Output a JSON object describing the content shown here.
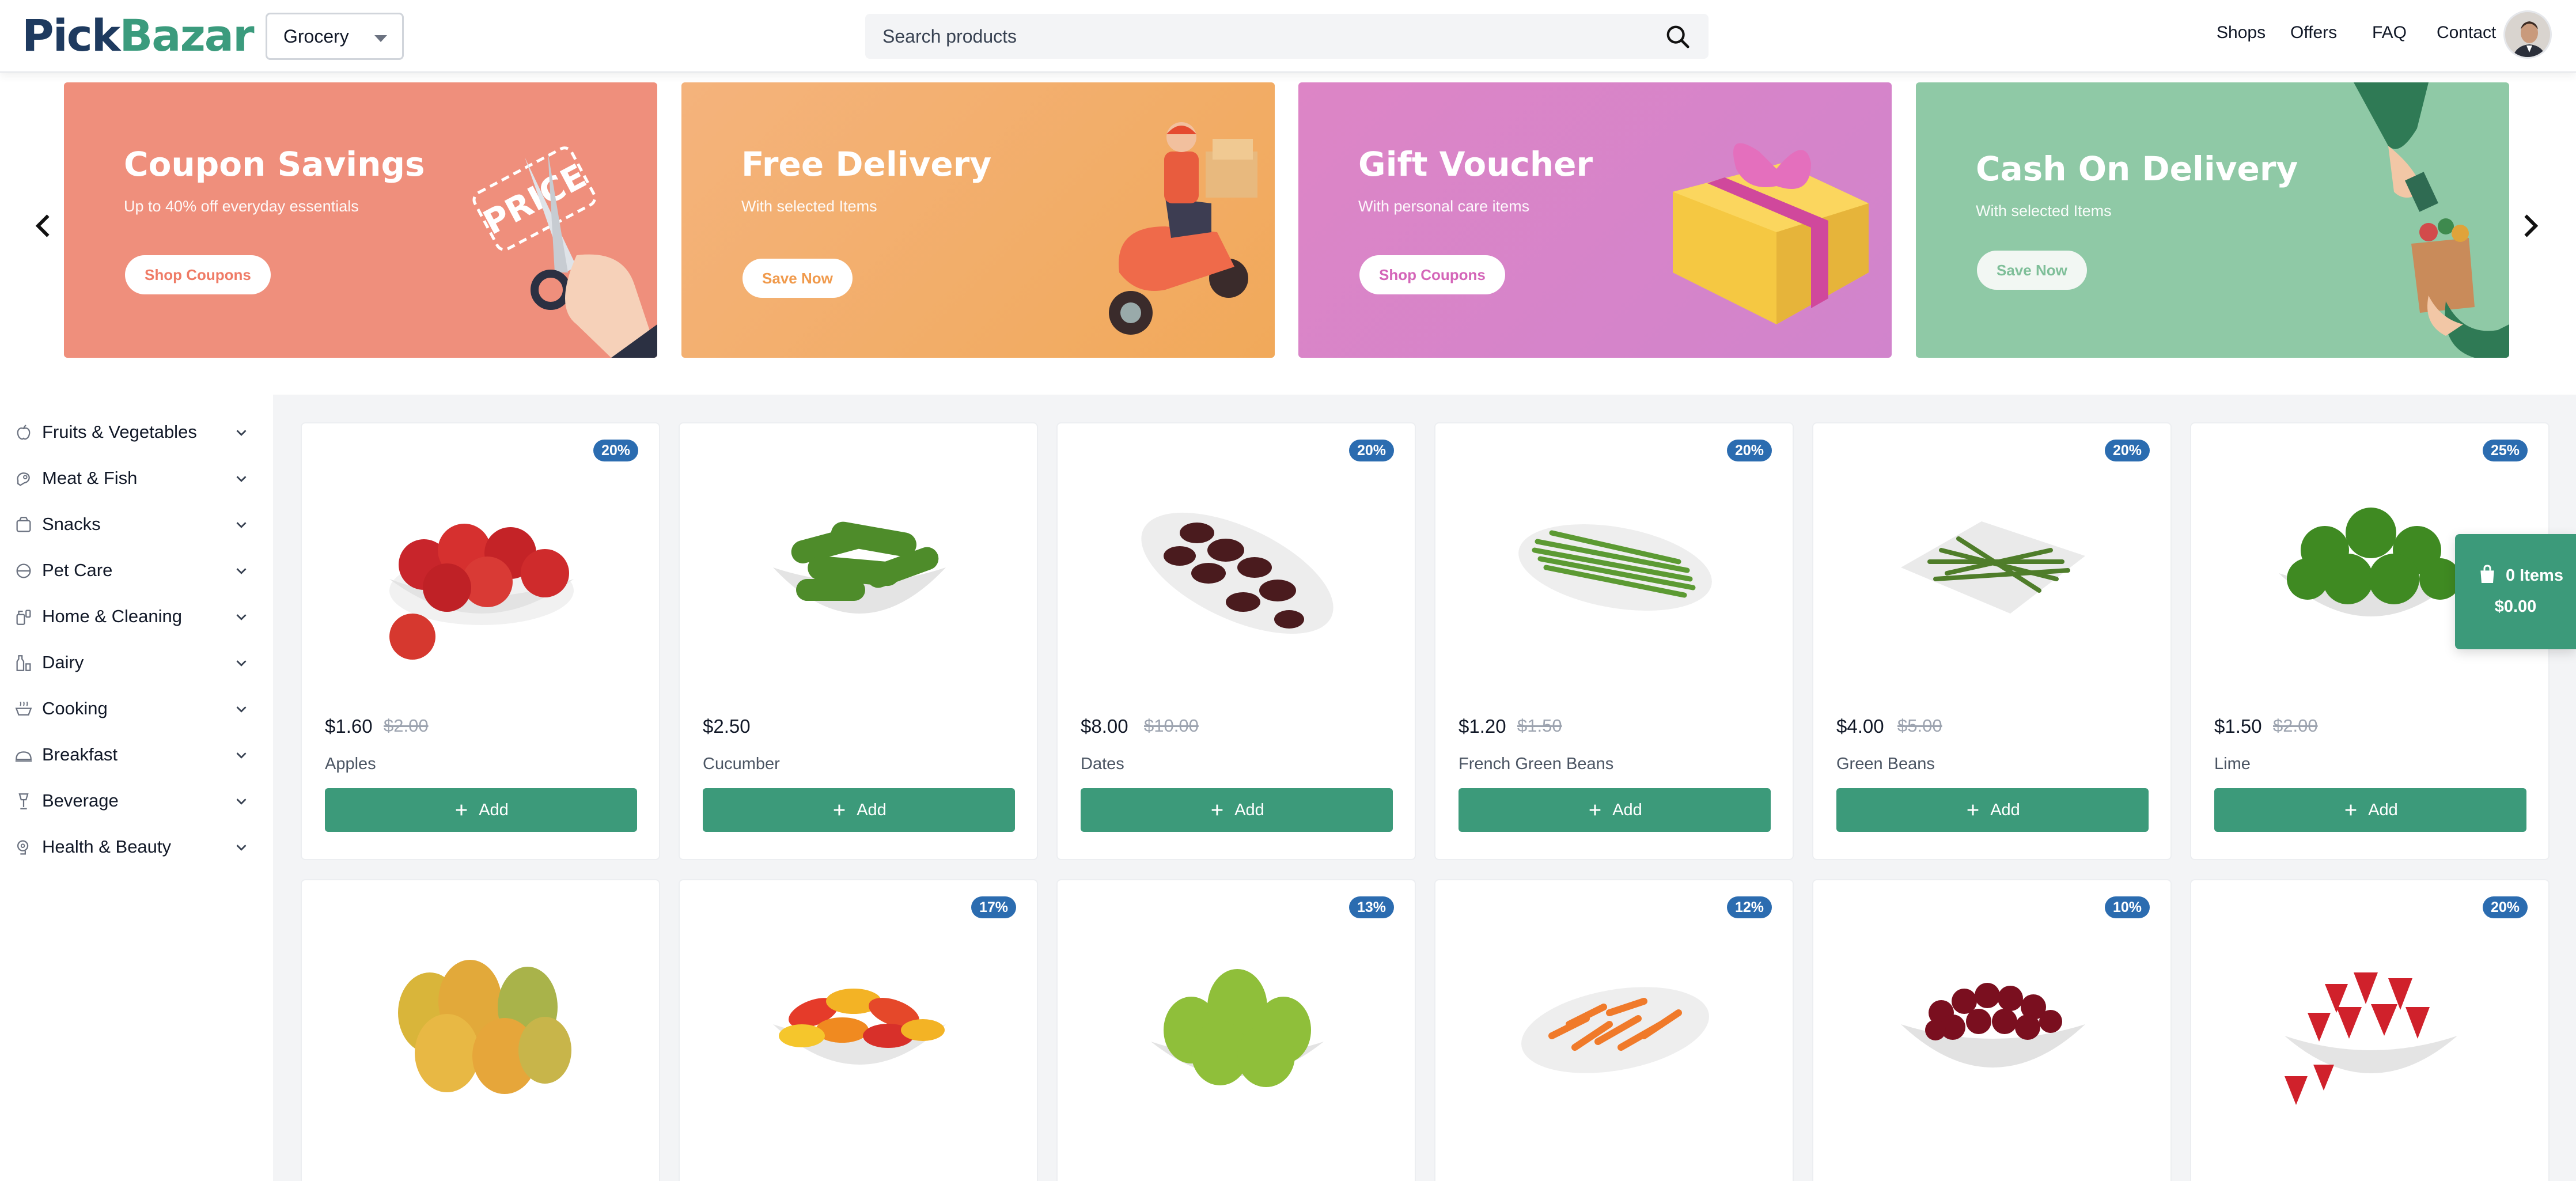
{
  "header": {
    "logo_part1": "Pick",
    "logo_part2": "Bazar",
    "type_select": "Grocery",
    "search_placeholder": "Search products",
    "nav": [
      "Shops",
      "Offers",
      "FAQ",
      "Contact"
    ]
  },
  "banners": [
    {
      "title": "Coupon Savings",
      "subtitle": "Up to 40% off everyday essentials",
      "button": "Shop Coupons",
      "art_text": "PRICE",
      "color": "#ef8f7c"
    },
    {
      "title": "Free Delivery",
      "subtitle": "With selected Items",
      "button": "Save Now",
      "color": "#f3ae6a"
    },
    {
      "title": "Gift Voucher",
      "subtitle": "With personal care items",
      "button": "Shop Coupons",
      "color": "#d985c8"
    },
    {
      "title": "Cash On Delivery",
      "subtitle": "With selected Items",
      "button": "Save Now",
      "color": "#8fc9a6"
    }
  ],
  "categories": [
    {
      "label": "Fruits & Vegetables",
      "icon": "apple-icon"
    },
    {
      "label": "Meat & Fish",
      "icon": "meat-icon"
    },
    {
      "label": "Snacks",
      "icon": "snack-icon"
    },
    {
      "label": "Pet Care",
      "icon": "pet-icon"
    },
    {
      "label": "Home & Cleaning",
      "icon": "cleaning-icon"
    },
    {
      "label": "Dairy",
      "icon": "dairy-icon"
    },
    {
      "label": "Cooking",
      "icon": "cooking-icon"
    },
    {
      "label": "Breakfast",
      "icon": "breakfast-icon"
    },
    {
      "label": "Beverage",
      "icon": "beverage-icon"
    },
    {
      "label": "Health & Beauty",
      "icon": "beauty-icon"
    }
  ],
  "products": [
    {
      "name": "Apples",
      "price": "$1.60",
      "old_price": "$2.00",
      "badge": "20%",
      "add": "Add"
    },
    {
      "name": "Cucumber",
      "price": "$2.50",
      "old_price": "",
      "badge": "",
      "add": "Add"
    },
    {
      "name": "Dates",
      "price": "$8.00",
      "old_price": "$10.00",
      "badge": "20%",
      "add": "Add"
    },
    {
      "name": "French Green Beans",
      "price": "$1.20",
      "old_price": "$1.50",
      "badge": "20%",
      "add": "Add"
    },
    {
      "name": "Green Beans",
      "price": "$4.00",
      "old_price": "$5.00",
      "badge": "20%",
      "add": "Add"
    },
    {
      "name": "Lime",
      "price": "$1.50",
      "old_price": "$2.00",
      "badge": "25%",
      "add": "Add"
    },
    {
      "name": "",
      "price": "",
      "old_price": "",
      "badge": "",
      "add": ""
    },
    {
      "name": "",
      "price": "",
      "old_price": "",
      "badge": "17%",
      "add": ""
    },
    {
      "name": "",
      "price": "",
      "old_price": "",
      "badge": "13%",
      "add": ""
    },
    {
      "name": "",
      "price": "",
      "old_price": "",
      "badge": "12%",
      "add": ""
    },
    {
      "name": "",
      "price": "",
      "old_price": "",
      "badge": "10%",
      "add": ""
    },
    {
      "name": "",
      "price": "",
      "old_price": "",
      "badge": "20%",
      "add": ""
    }
  ],
  "cart": {
    "items": "0 Items",
    "total": "$0.00"
  },
  "colors": {
    "accent": "#3c9a7a",
    "badge": "#2b6cb0",
    "logo_dark": "#1e3a5f"
  }
}
